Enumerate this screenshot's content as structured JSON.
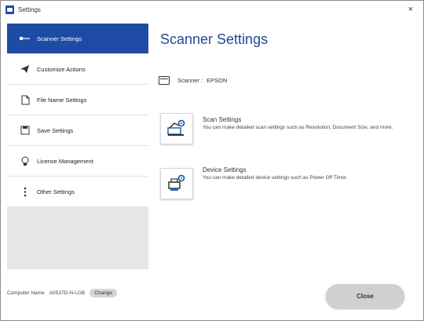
{
  "window": {
    "title": "Settings",
    "close_glyph": "×"
  },
  "sidebar": {
    "items": [
      {
        "label": "Scanner Settings",
        "icon": "scanner-arrow-icon",
        "active": true
      },
      {
        "label": "Customize Actions",
        "icon": "send-icon",
        "active": false
      },
      {
        "label": "File Name Settings",
        "icon": "file-icon",
        "active": false
      },
      {
        "label": "Save Settings",
        "icon": "save-icon",
        "active": false
      },
      {
        "label": "License Management",
        "icon": "lightbulb-icon",
        "active": false
      },
      {
        "label": "Other Settings",
        "icon": "more-vertical-icon",
        "active": false
      }
    ]
  },
  "main": {
    "title": "Scanner Settings",
    "scanner_label": "Scanner :",
    "scanner_value": "EPSON",
    "scan_settings": {
      "title": "Scan Settings",
      "description": "You can make detailed scan settings such as Resolution, Document Size, and more."
    },
    "device_settings": {
      "title": "Device Settings",
      "description": "You can make detailed device settings such as Power Off Timer."
    }
  },
  "footer": {
    "computer_name_label": "Computer Name",
    "computer_name_value": "A0537D-N-LGB",
    "change_label": "Change",
    "close_label": "Close"
  },
  "colors": {
    "accent": "#1e4ca4",
    "title": "#1e4a96",
    "sidebar_bg": "#e6e6e6",
    "button": "#d0d0d0"
  }
}
